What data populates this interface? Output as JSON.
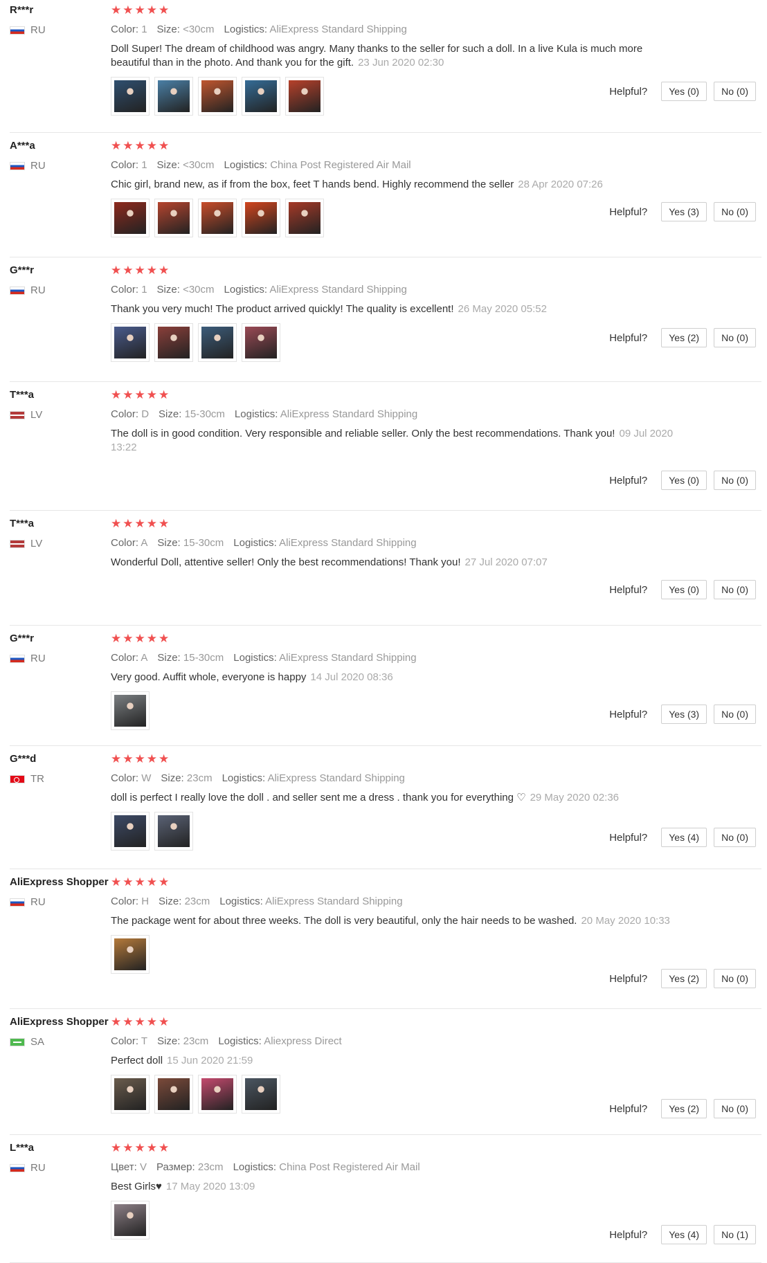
{
  "labels": {
    "helpful": "Helpful?"
  },
  "stars": "★★★★★",
  "reviews": [
    {
      "user": "R***r",
      "country": "RU",
      "attrs": [
        {
          "k": "Color:",
          "v": "1"
        },
        {
          "k": "Size:",
          "v": "<30cm"
        },
        {
          "k": "Logistics:",
          "v": "AliExpress Standard Shipping"
        }
      ],
      "text": "Doll Super! The dream of childhood was angry. Many thanks to the seller for such a doll. In a live Kula is much more beautiful than in the photo. And thank you for the gift.",
      "date": "23 Jun 2020 02:30",
      "yes": "Yes (0)",
      "no": "No (0)"
    },
    {
      "user": "A***a",
      "country": "RU",
      "attrs": [
        {
          "k": "Color:",
          "v": "1"
        },
        {
          "k": "Size:",
          "v": "<30cm"
        },
        {
          "k": "Logistics:",
          "v": "China Post Registered Air Mail"
        }
      ],
      "text": "Chic girl, brand new, as if from the box, feet T hands bend. Highly recommend the seller",
      "date": "28 Apr 2020 07:26",
      "yes": "Yes (3)",
      "no": "No (0)"
    },
    {
      "user": "G***r",
      "country": "RU",
      "attrs": [
        {
          "k": "Color:",
          "v": "1"
        },
        {
          "k": "Size:",
          "v": "<30cm"
        },
        {
          "k": "Logistics:",
          "v": "AliExpress Standard Shipping"
        }
      ],
      "text": "Thank you very much! The product arrived quickly! The quality is excellent!",
      "date": "26 May 2020 05:52",
      "yes": "Yes (2)",
      "no": "No (0)"
    },
    {
      "user": "T***a",
      "country": "LV",
      "attrs": [
        {
          "k": "Color:",
          "v": "D"
        },
        {
          "k": "Size:",
          "v": "15-30cm"
        },
        {
          "k": "Logistics:",
          "v": "AliExpress Standard Shipping"
        }
      ],
      "text": "The doll is in good condition. Very responsible and reliable seller. Only the best recommendations. Thank you!",
      "date": "09 Jul 2020 13:22",
      "yes": "Yes (0)",
      "no": "No (0)"
    },
    {
      "user": "T***a",
      "country": "LV",
      "attrs": [
        {
          "k": "Color:",
          "v": "A"
        },
        {
          "k": "Size:",
          "v": "15-30cm"
        },
        {
          "k": "Logistics:",
          "v": "AliExpress Standard Shipping"
        }
      ],
      "text": "Wonderful Doll, attentive seller! Only the best recommendations! Thank you!",
      "date": "27 Jul 2020 07:07",
      "yes": "Yes (0)",
      "no": "No (0)"
    },
    {
      "user": "G***r",
      "country": "RU",
      "attrs": [
        {
          "k": "Color:",
          "v": "A"
        },
        {
          "k": "Size:",
          "v": "15-30cm"
        },
        {
          "k": "Logistics:",
          "v": "AliExpress Standard Shipping"
        }
      ],
      "text": "Very good. Auffit whole, everyone is happy",
      "date": "14 Jul 2020 08:36",
      "yes": "Yes (3)",
      "no": "No (0)"
    },
    {
      "user": "G***d",
      "country": "TR",
      "attrs": [
        {
          "k": "Color:",
          "v": "W"
        },
        {
          "k": "Size:",
          "v": "23cm"
        },
        {
          "k": "Logistics:",
          "v": "AliExpress Standard Shipping"
        }
      ],
      "text": "doll is perfect I really love the doll . and seller sent me a dress . thank you for everything ♡",
      "date": "29 May 2020 02:36",
      "yes": "Yes (4)",
      "no": "No (0)"
    },
    {
      "user": "AliExpress Shopper",
      "country": "RU",
      "attrs": [
        {
          "k": "Color:",
          "v": "H"
        },
        {
          "k": "Size:",
          "v": "23cm"
        },
        {
          "k": "Logistics:",
          "v": "AliExpress Standard Shipping"
        }
      ],
      "text": "The package went for about three weeks. The doll is very beautiful, only the hair needs to be washed.",
      "date": "20 May 2020 10:33",
      "yes": "Yes (2)",
      "no": "No (0)"
    },
    {
      "user": "AliExpress Shopper",
      "country": "SA",
      "attrs": [
        {
          "k": "Color:",
          "v": "T"
        },
        {
          "k": "Size:",
          "v": "23cm"
        },
        {
          "k": "Logistics:",
          "v": "Aliexpress Direct"
        }
      ],
      "text": "Perfect doll",
      "date": "15 Jun 2020 21:59",
      "yes": "Yes (2)",
      "no": "No (0)"
    },
    {
      "user": "L***a",
      "country": "RU",
      "attrs": [
        {
          "k": "Цвет:",
          "v": "V"
        },
        {
          "k": "Размер:",
          "v": "23cm"
        },
        {
          "k": "Logistics:",
          "v": "China Post Registered Air Mail"
        }
      ],
      "text": "Best Girls♥",
      "date": "17 May 2020 13:09",
      "yes": "Yes (4)",
      "no": "No (1)"
    }
  ]
}
